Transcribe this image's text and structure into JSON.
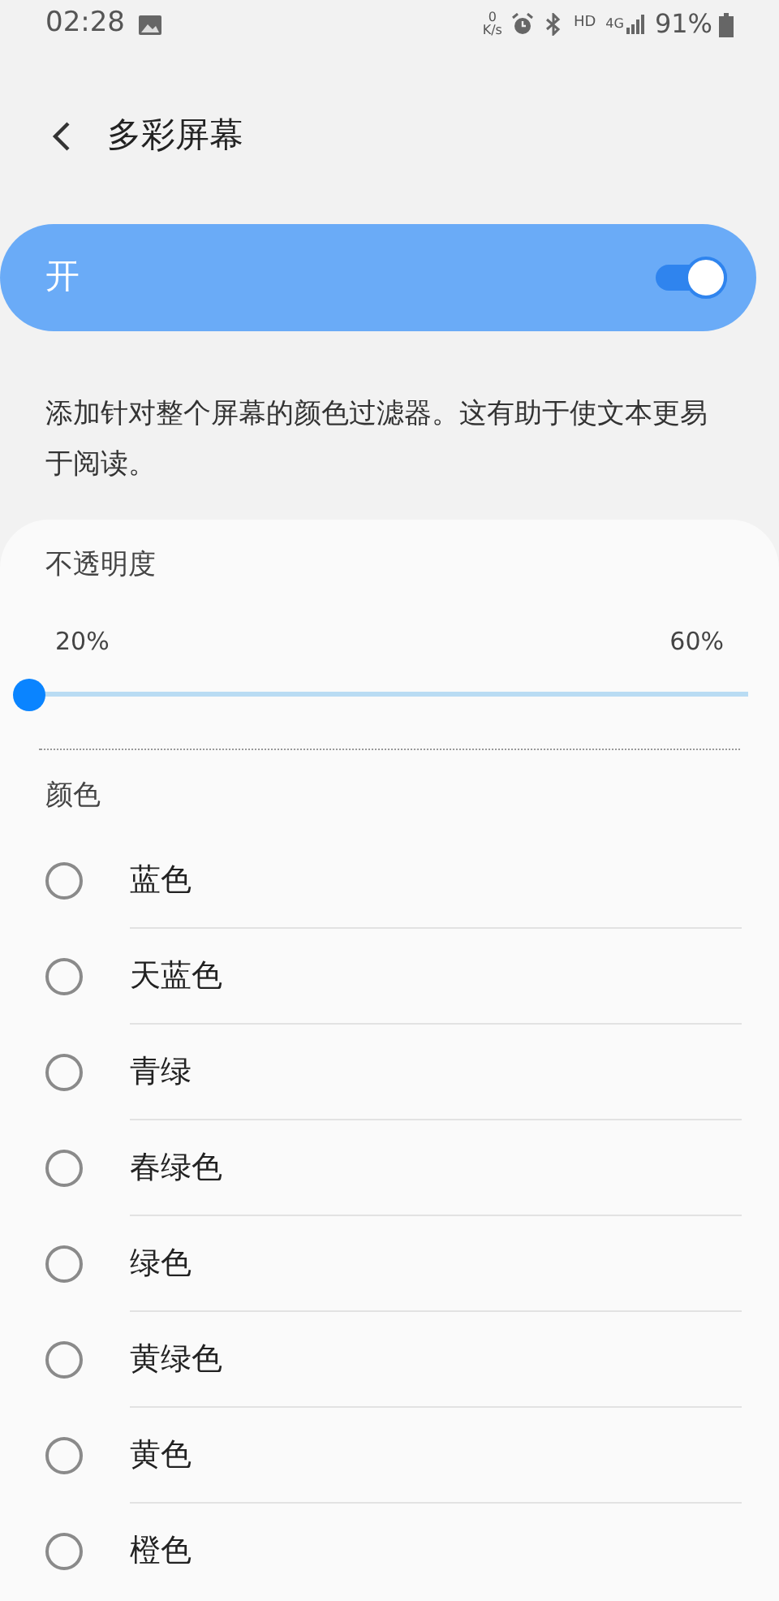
{
  "status_bar": {
    "time": "02:28",
    "net_speed_value": "0",
    "net_speed_unit": "K/s",
    "hd": "HD",
    "network": "4G",
    "battery": "91%"
  },
  "header": {
    "title": "多彩屏幕"
  },
  "master_switch": {
    "label": "开",
    "on": true
  },
  "description": "添加针对整个屏幕的颜色过滤器。这有助于使文本更易于阅读。",
  "opacity": {
    "title": "不透明度",
    "min_label": "20%",
    "max_label": "60%",
    "level": 0
  },
  "colors": {
    "title": "颜色",
    "options": [
      {
        "label": "蓝色",
        "selected": false
      },
      {
        "label": "天蓝色",
        "selected": false
      },
      {
        "label": "青绿",
        "selected": false
      },
      {
        "label": "春绿色",
        "selected": false
      },
      {
        "label": "绿色",
        "selected": false
      },
      {
        "label": "黄绿色",
        "selected": false
      },
      {
        "label": "黄色",
        "selected": false
      },
      {
        "label": "橙色",
        "selected": false
      }
    ]
  }
}
